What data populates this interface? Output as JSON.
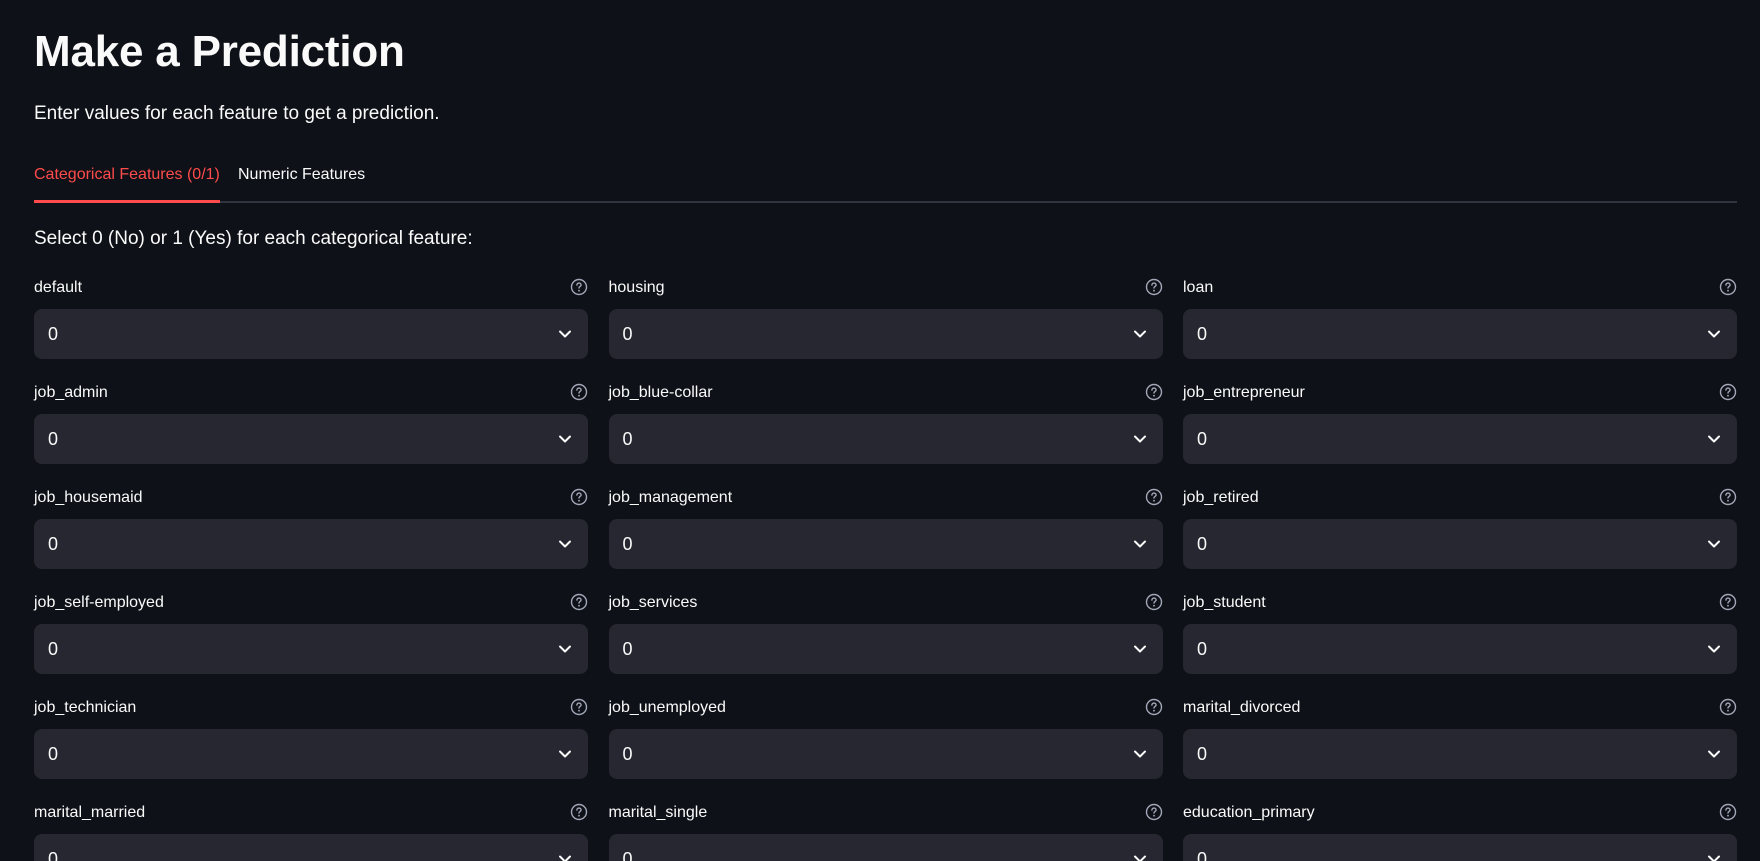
{
  "page": {
    "title": "Make a Prediction",
    "subtitle": "Enter values for each feature to get a prediction.",
    "instruction": "Select 0 (No) or 1 (Yes) for each categorical feature:"
  },
  "tabs": [
    {
      "label": "Categorical Features (0/1)",
      "active": true
    },
    {
      "label": "Numeric Features",
      "active": false
    }
  ],
  "fields": [
    {
      "label": "default",
      "value": "0"
    },
    {
      "label": "housing",
      "value": "0"
    },
    {
      "label": "loan",
      "value": "0"
    },
    {
      "label": "job_admin",
      "value": "0"
    },
    {
      "label": "job_blue-collar",
      "value": "0"
    },
    {
      "label": "job_entrepreneur",
      "value": "0"
    },
    {
      "label": "job_housemaid",
      "value": "0"
    },
    {
      "label": "job_management",
      "value": "0"
    },
    {
      "label": "job_retired",
      "value": "0"
    },
    {
      "label": "job_self-employed",
      "value": "0"
    },
    {
      "label": "job_services",
      "value": "0"
    },
    {
      "label": "job_student",
      "value": "0"
    },
    {
      "label": "job_technician",
      "value": "0"
    },
    {
      "label": "job_unemployed",
      "value": "0"
    },
    {
      "label": "marital_divorced",
      "value": "0"
    },
    {
      "label": "marital_married",
      "value": "0"
    },
    {
      "label": "marital_single",
      "value": "0"
    },
    {
      "label": "education_primary",
      "value": "0"
    }
  ],
  "icons": {
    "help": "help-circle-icon",
    "dropdown": "chevron-down-icon"
  },
  "colors": {
    "background": "#0e1117",
    "select_background": "#262730",
    "accent": "#ff4b4b",
    "text": "#fafafa",
    "divider": "#31333f"
  }
}
